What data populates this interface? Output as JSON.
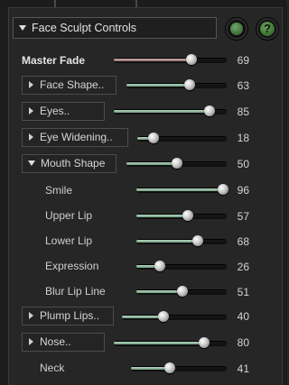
{
  "panel": {
    "title": "Face Sculpt Controls",
    "help_label": "?"
  },
  "controls": [
    {
      "id": "master-fade",
      "label": "Master Fade",
      "value": 69,
      "style": "bold",
      "fill": "red"
    },
    {
      "id": "face-shape",
      "label": "Face Shape..",
      "value": 63,
      "style": "collapsed"
    },
    {
      "id": "eyes",
      "label": "Eyes..",
      "value": 85,
      "style": "collapsed"
    },
    {
      "id": "eye-widening",
      "label": "Eye Widening..",
      "value": 18,
      "style": "collapsed"
    },
    {
      "id": "mouth-shape",
      "label": "Mouth Shape",
      "value": 50,
      "style": "expanded"
    },
    {
      "id": "smile",
      "label": "Smile",
      "value": 96,
      "style": "sub"
    },
    {
      "id": "upper-lip",
      "label": "Upper Lip",
      "value": 57,
      "style": "sub"
    },
    {
      "id": "lower-lip",
      "label": "Lower Lip",
      "value": 68,
      "style": "sub"
    },
    {
      "id": "expression",
      "label": "Expression",
      "value": 26,
      "style": "sub"
    },
    {
      "id": "blur-lip-line",
      "label": "Blur Lip Line",
      "value": 51,
      "style": "sub"
    },
    {
      "id": "plump-lips",
      "label": "Plump Lips..",
      "value": 40,
      "style": "collapsed"
    },
    {
      "id": "nose",
      "label": "Nose..",
      "value": 80,
      "style": "collapsed"
    },
    {
      "id": "neck",
      "label": "Neck",
      "value": 41,
      "style": "plain"
    }
  ]
}
